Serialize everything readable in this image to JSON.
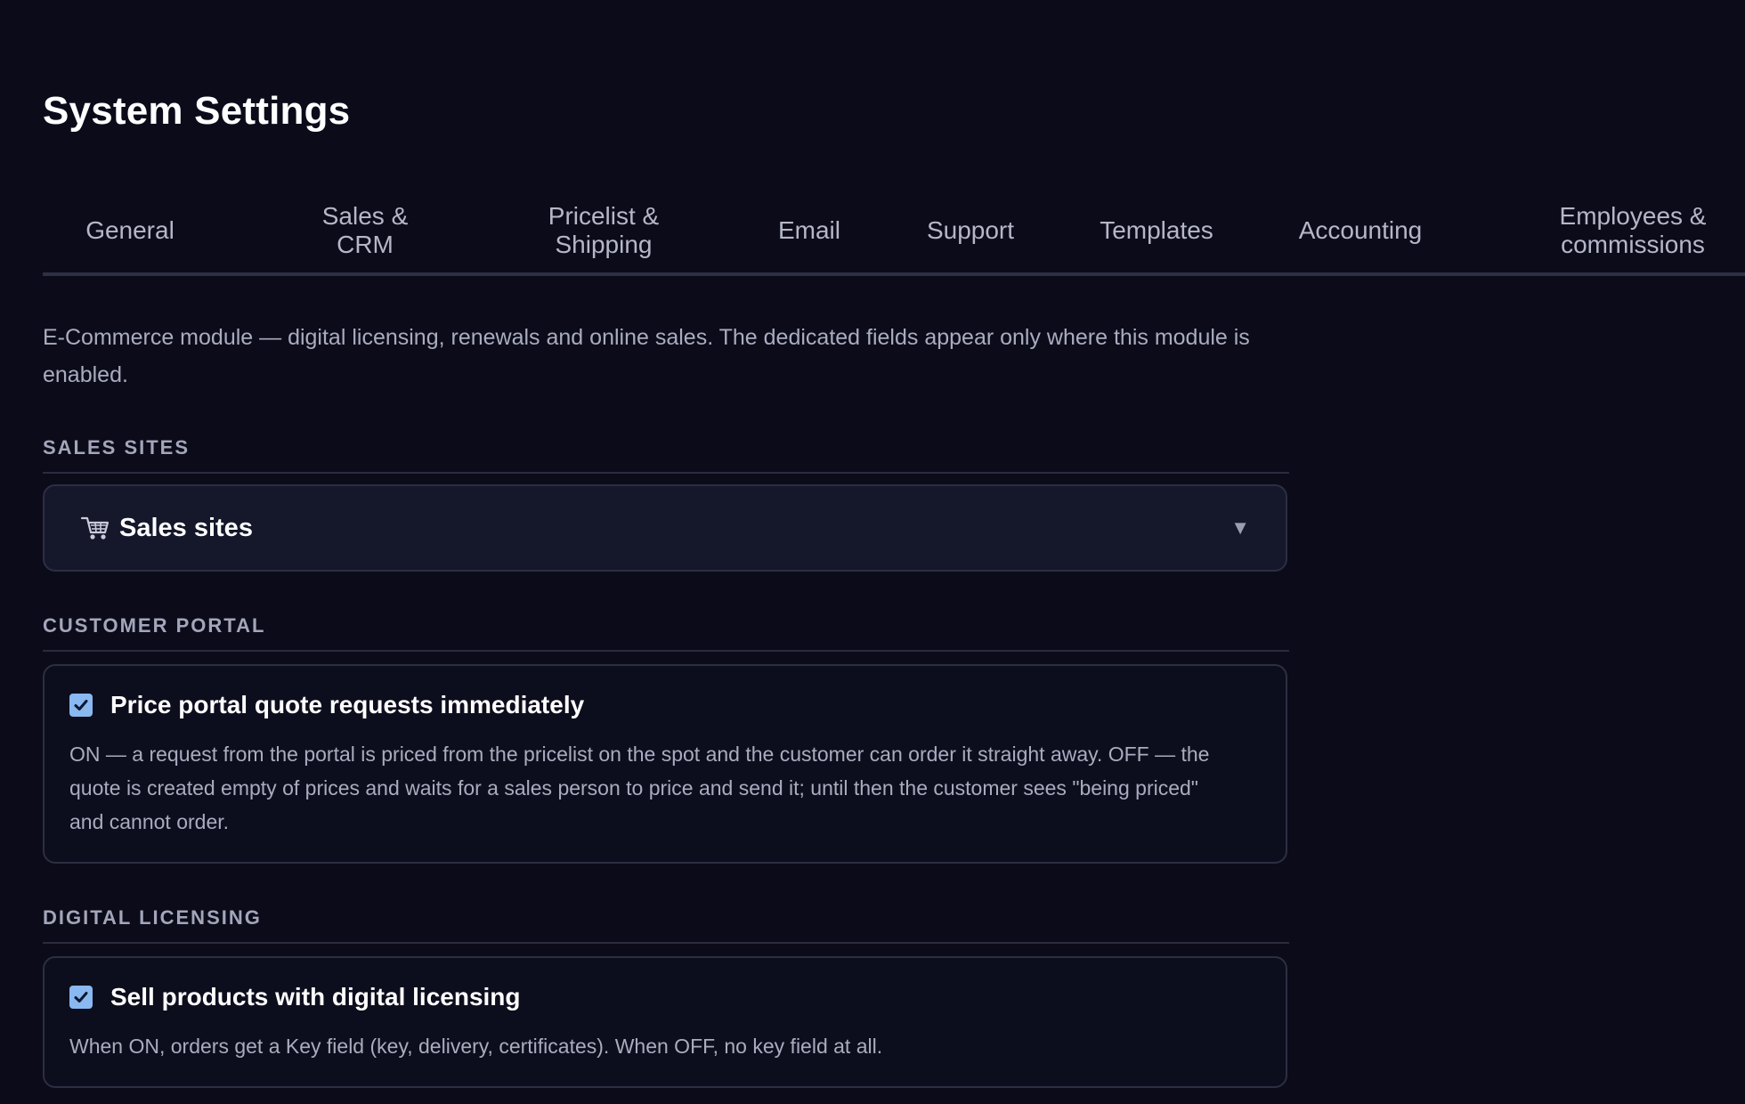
{
  "page": {
    "title": "System Settings"
  },
  "tabs": [
    {
      "label": "General"
    },
    {
      "label": "Sales &\nCRM"
    },
    {
      "label": "Pricelist &\nShipping"
    },
    {
      "label": "Email"
    },
    {
      "label": "Support"
    },
    {
      "label": "Templates"
    },
    {
      "label": "Accounting"
    },
    {
      "label": "Employees &\ncommissions"
    }
  ],
  "intro": "E-Commerce module — digital licensing, renewals and online sales. The dedicated fields appear only where this module is enabled.",
  "sections": {
    "sales_sites": {
      "heading": "SALES SITES",
      "panel": {
        "icon": "shopping-cart-icon",
        "title": "Sales sites",
        "expanded": false,
        "caret": "▼"
      }
    },
    "customer_portal": {
      "heading": "CUSTOMER PORTAL",
      "option": {
        "checked": true,
        "title": "Price portal quote requests immediately",
        "description": "ON — a request from the portal is priced from the pricelist on the spot and the customer can order it straight away. OFF — the quote is created empty of prices and waits for a sales person to price and send it; until then the customer sees \"being priced\" and cannot order."
      }
    },
    "digital_licensing": {
      "heading": "DIGITAL LICENSING",
      "option": {
        "checked": true,
        "title": "Sell products with digital licensing",
        "description": "When ON, orders get a Key field (key, delivery, certificates). When OFF, no key field at all."
      }
    }
  },
  "colors": {
    "background": "#0b0b1a",
    "checkbox_accent": "#8ab8f0",
    "panel_background": "#15172a",
    "border": "#2c2e42"
  }
}
